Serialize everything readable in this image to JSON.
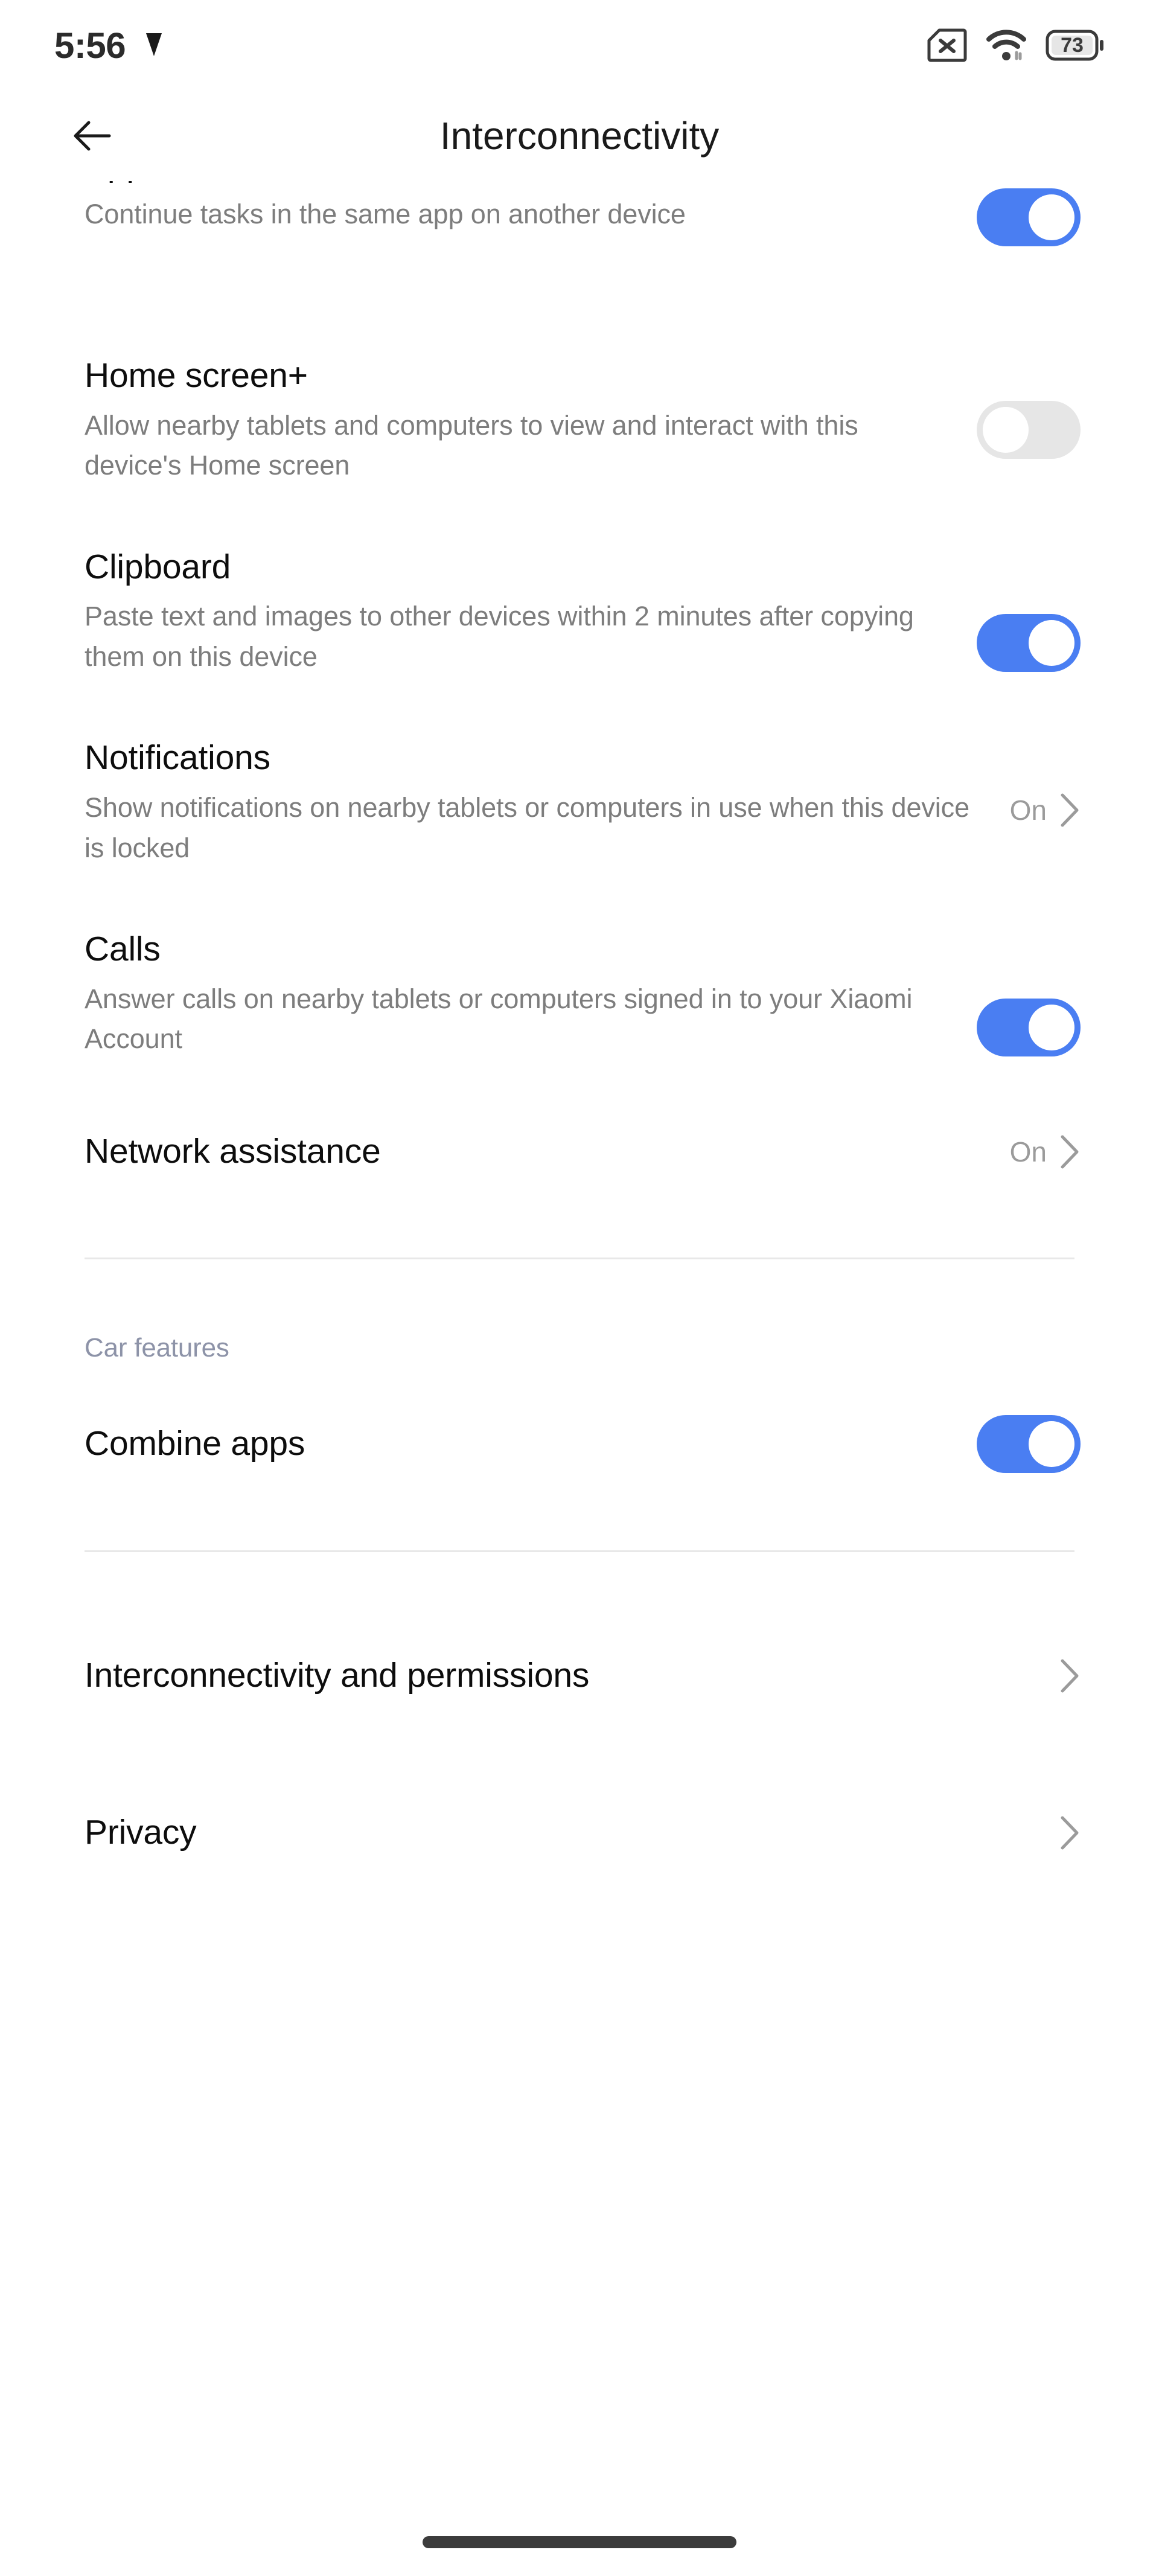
{
  "status_bar": {
    "time": "5:56",
    "alarm_icon": "alarm-clock-icon",
    "sim_icon": "sim-card-off-icon",
    "wifi_icon": "wifi-icon",
    "battery_icon": "battery-icon",
    "battery_level": "73"
  },
  "app_bar": {
    "back_icon": "arrow-left-icon",
    "title": "Interconnectivity"
  },
  "settings": [
    {
      "title": "Apps",
      "description": "Continue tasks in the same app on another device",
      "control": "toggle",
      "state": "on"
    },
    {
      "title": "Home screen+",
      "description": "Allow nearby tablets and computers to view and interact with this device's Home screen",
      "control": "toggle",
      "state": "off"
    },
    {
      "title": "Clipboard",
      "description": "Paste text and images to other devices within 2 minutes after copying them on this device",
      "control": "toggle",
      "state": "on"
    },
    {
      "title": "Notifications",
      "description": "Show notifications on nearby tablets or computers in use when this device is locked",
      "control": "value",
      "value": "On"
    },
    {
      "title": "Calls",
      "description": "Answer calls on nearby tablets or computers signed in to your Xiaomi Account",
      "control": "toggle",
      "state": "on"
    },
    {
      "title": "Network assistance",
      "description": "",
      "control": "value",
      "value": "On"
    }
  ],
  "car_section": {
    "header": "Car features",
    "items": [
      {
        "title": "Combine apps",
        "control": "toggle",
        "state": "on"
      }
    ]
  },
  "footer_links": [
    {
      "title": "Interconnectivity and permissions"
    },
    {
      "title": "Privacy"
    }
  ],
  "colors": {
    "toggle_on": "#4a7ef2",
    "toggle_off": "#e6e6e6",
    "title_text": "#0d0d0d",
    "desc_text": "#7d7d7d",
    "value_text": "#9b9b9b",
    "section_header": "#8d93a8",
    "divider": "#e8e8e8",
    "home_indicator": "#3c3c3c"
  }
}
